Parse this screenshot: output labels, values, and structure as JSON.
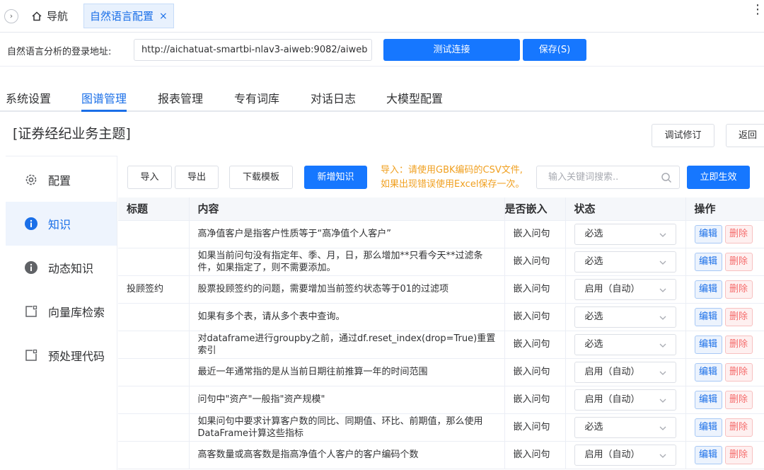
{
  "topbar": {
    "nav_label": "导航",
    "active_tab_label": "自然语言配置",
    "close_glyph": "×",
    "more_glyph": "⋮",
    "collapse_glyph": "›"
  },
  "connection": {
    "label": "自然语言分析的登录地址:",
    "url_value": "http://aichatuat-smartbi-nlav3-aiweb:9082/aiweb",
    "test_button": "测试连接",
    "save_button": "保存(S)"
  },
  "main_tabs": [
    "系统设置",
    "图谱管理",
    "报表管理",
    "专有词库",
    "对话日志",
    "大模型配置"
  ],
  "active_main_tab": "图谱管理",
  "subject": {
    "title": "[证券经纪业务主题]",
    "debug_button": "调试修订",
    "back_button": "返回"
  },
  "sidebar": {
    "items": [
      {
        "label": "配置",
        "icon": "gear-icon"
      },
      {
        "label": "知识",
        "icon": "info-icon"
      },
      {
        "label": "动态知识",
        "icon": "info-icon"
      },
      {
        "label": "向量库检索",
        "icon": "box-icon"
      },
      {
        "label": "预处理代码",
        "icon": "box-icon"
      }
    ],
    "active": "知识"
  },
  "toolbar": {
    "import_button": "导入",
    "export_button": "导出",
    "download_template_button": "下载模板",
    "add_knowledge_button": "新增知识",
    "hint_line1": "导入：请使用GBK编码的CSV文件,",
    "hint_line2": "如果出现错误使用Excel保存一次。",
    "search_placeholder": "输入关键词搜索..",
    "apply_button": "立即生效"
  },
  "table": {
    "headers": [
      "标题",
      "内容",
      "是否嵌入",
      "状态",
      "操作"
    ],
    "edit_label": "编辑",
    "delete_label": "删除",
    "rows": [
      {
        "title": "",
        "content": "高净值客户是指客户性质等于“高净值个人客户”",
        "embed": "嵌入问句",
        "status": "必选"
      },
      {
        "title": "",
        "content": "如果当前问句没有指定年、季、月，日，那么增加**只看今天**过滤条件，如果指定了，则不需要添加。",
        "embed": "嵌入问句",
        "status": "必选"
      },
      {
        "title": "投顾签约",
        "content": "股票投顾签约的问题，需要增加当前签约状态等于01的过滤项",
        "embed": "嵌入问句",
        "status": "启用（自动）"
      },
      {
        "title": "",
        "content": "如果有多个表，请从多个表中查询。",
        "embed": "嵌入问句",
        "status": "必选"
      },
      {
        "title": "",
        "content": "对dataframe进行groupby之前，通过df.reset_index(drop=True)重置索引",
        "embed": "嵌入问句",
        "status": "必选"
      },
      {
        "title": "",
        "content": "最近一年通常指的是从当前日期往前推算一年的时间范围",
        "embed": "嵌入问句",
        "status": "启用（自动）"
      },
      {
        "title": "",
        "content": "问句中\"资产\"一般指\"资产规模\"",
        "embed": "嵌入问句",
        "status": "启用（自动）"
      },
      {
        "title": "",
        "content": "如果问句中要求计算客户数的同比、同期值、环比、前期值，那么使用DataFrame计算这些指标",
        "embed": "嵌入问句",
        "status": "必选"
      },
      {
        "title": "",
        "content": "高客数量或高客数是指高净值个人客户的客户编码个数",
        "embed": "嵌入问句",
        "status": "启用（自动）"
      }
    ]
  },
  "colors": {
    "accent": "#1677ff",
    "warning_text": "#f0a020",
    "danger": "#f56c6c"
  }
}
